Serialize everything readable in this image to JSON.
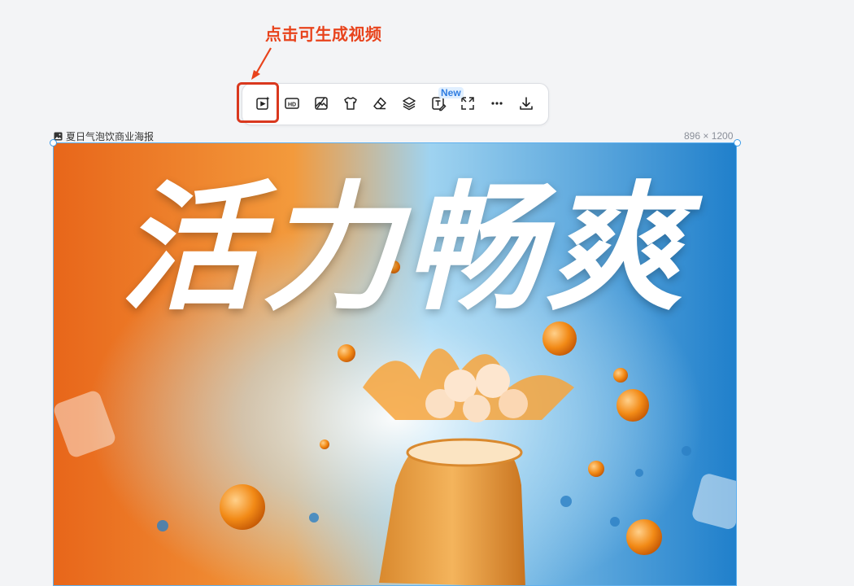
{
  "annotation": {
    "text": "点击可生成视频"
  },
  "toolbar": {
    "new_badge": "New",
    "hd_label": "HD"
  },
  "image": {
    "name": "夏日气泡饮商业海报",
    "dimensions": "896 × 1200",
    "headline": "活力畅爽"
  },
  "colors": {
    "annotation_red": "#e8431c",
    "highlight_red": "#d9381e",
    "selection_blue": "#5fb1f0",
    "badge_blue": "#2f7de1"
  },
  "icons": [
    "video-sparkle-icon",
    "hd-icon",
    "image-edit-icon",
    "tshirt-icon",
    "eraser-icon",
    "layers-icon",
    "text-edit-icon",
    "expand-icon",
    "more-icon",
    "download-icon"
  ]
}
